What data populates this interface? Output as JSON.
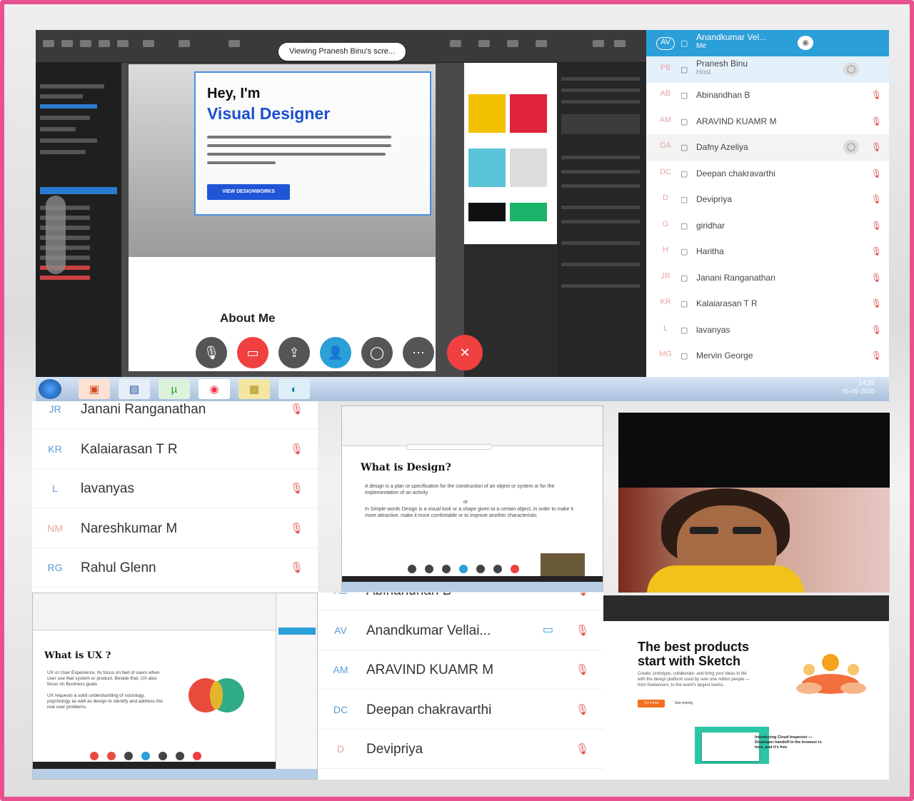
{
  "meeting": {
    "viewing_label": "Viewing Pranesh Binu's scre...",
    "hero_hey": "Hey, I'm",
    "hero_title": "Visual Designer",
    "hero_button": "VIEW DESIGNWORKS",
    "about_title": "About Me"
  },
  "participants_top": [
    {
      "initials": "AV",
      "name": "Anandkumar Vel...",
      "sub": "Me",
      "highlight": true
    },
    {
      "initials": "PB",
      "name": "Pranesh Binu",
      "sub": "Host",
      "host": true
    },
    {
      "initials": "AB",
      "name": "Abinandhan B"
    },
    {
      "initials": "AM",
      "name": "ARAVIND KUAMR M"
    },
    {
      "initials": "DA",
      "name": "Dafny Azeliya",
      "chat": true
    },
    {
      "initials": "DC",
      "name": "Deepan chakravarthi"
    },
    {
      "initials": "D",
      "name": "Devipriya"
    },
    {
      "initials": "G",
      "name": "giridhar"
    },
    {
      "initials": "H",
      "name": "Haritha"
    },
    {
      "initials": "JR",
      "name": "Janani Ranganathan"
    },
    {
      "initials": "KR",
      "name": "Kalaiarasan T R"
    },
    {
      "initials": "L",
      "name": "lavanyas"
    },
    {
      "initials": "MG",
      "name": "Mervin George"
    }
  ],
  "taskbar": {
    "time": "14:25",
    "date": "05-05-2020"
  },
  "participants_bottom_left": [
    {
      "initials": "JR",
      "name": "Janani Ranganathan"
    },
    {
      "initials": "KR",
      "name": "Kalaiarasan T R"
    },
    {
      "initials": "L",
      "name": "lavanyas"
    },
    {
      "initials": "NM",
      "name": "Nareshkumar M"
    },
    {
      "initials": "RG",
      "name": "Rahul Glenn"
    }
  ],
  "design_slide": {
    "title": "What is Design?",
    "bullet1": "A design is a plan or specification for the construction of an object or system or for the implementation of an activity",
    "or": "or",
    "bullet2": "In Simple words Design is a visual look or a shape given to a certain object, in order to make it more attractive, make it more comfortable or to improve another characteristic"
  },
  "ux_slide": {
    "title": "What is UX ?",
    "bullet1": "UX or User Experience, its focus on feel of users when user use that system or product. Beside that, UX also focus on Business goals",
    "bullet2": "UX requests a solid understanding of sociology, psychology as well as design to identify and address the real user problems."
  },
  "participants_bottom_mid": [
    {
      "initials": "AB",
      "name": "Abinandhan B"
    },
    {
      "initials": "AV",
      "name": "Anandkumar Vellai...",
      "video": true
    },
    {
      "initials": "AM",
      "name": "ARAVIND KUAMR M"
    },
    {
      "initials": "DC",
      "name": "Deepan chakravarthi"
    },
    {
      "initials": "D",
      "name": "Devipriya"
    }
  ],
  "sketch_site": {
    "title_line1": "The best products",
    "title_line2": "start with Sketch",
    "body": "Create, prototype, collaborate, and bring your ideas to life with the design platform used by over one million people — from freelancers, to the world's largest teams.",
    "cta": "Try it free",
    "secondary": "See pricing",
    "promo": "Introducing Cloud Inspector — Developer handoff in the browser is here, and it's free"
  },
  "colors": {
    "frame": "#e9508f",
    "accent": "#2a9fd8",
    "end_call": "#f04040",
    "mic_off": "#e04e4e"
  }
}
